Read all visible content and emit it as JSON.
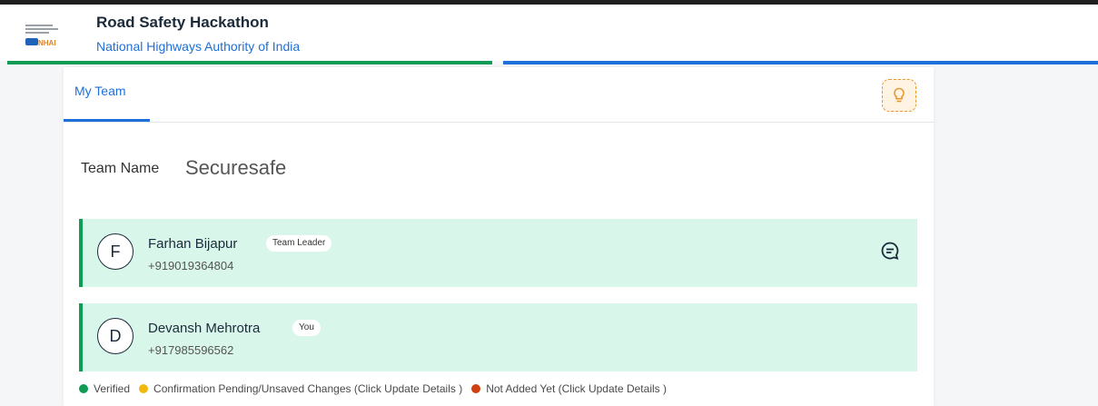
{
  "header": {
    "title": "Road Safety Hackathon",
    "subtitle": "National Highways Authority of India",
    "logo_text": "NHAI",
    "logo_icon": "nhai-logo-icon"
  },
  "colors": {
    "brand_blue": "#1e6fd9",
    "success_green": "#109c55",
    "pending_yellow": "#f2b90c",
    "error_red": "#d1400f",
    "member_bg": "#d8f6ea"
  },
  "tabs": [
    {
      "label": "My Team",
      "active": true
    }
  ],
  "hint_button_icon": "lightbulb-icon",
  "team": {
    "label": "Team Name",
    "name": "Securesafe"
  },
  "members": [
    {
      "initial": "F",
      "name": "Farhan Bijapur",
      "badge": "Team Leader",
      "phone": "+919019364804",
      "status": "verified",
      "action_icon": "chat-icon"
    },
    {
      "initial": "D",
      "name": "Devansh Mehrotra",
      "badge": "You",
      "phone": "+917985596562",
      "status": "verified"
    }
  ],
  "legend": [
    {
      "label": "Verified",
      "color": "#109c55"
    },
    {
      "label": "Confirmation Pending/Unsaved Changes (Click Update Details )",
      "color": "#f2b90c"
    },
    {
      "label": "Not Added Yet (Click Update Details )",
      "color": "#d1400f"
    }
  ]
}
